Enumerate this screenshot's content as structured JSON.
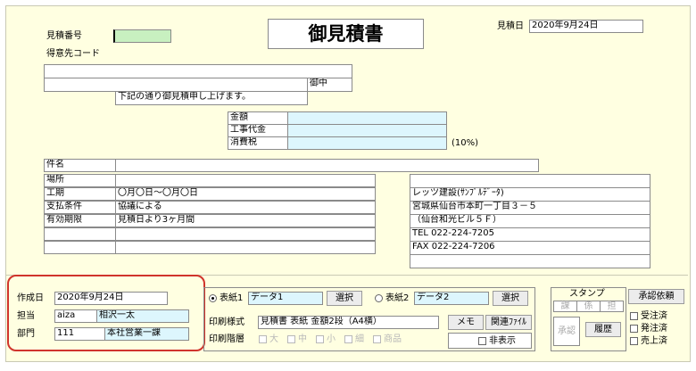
{
  "header": {
    "estimate_no_label": "見積番号",
    "estimate_no_value": "",
    "customer_code_label": "得意先コード",
    "title": "御見積書",
    "date_label": "見積日",
    "date_value": "2020年9月24日"
  },
  "address": {
    "line1": "",
    "line2": "",
    "honorific": "御中",
    "greeting": "下記の通り御見積申し上げます。"
  },
  "amounts": {
    "total_label": "金額",
    "construction_label": "工事代金",
    "tax_label": "消費税",
    "tax_rate": "(10%)"
  },
  "details": {
    "subject_label": "件名",
    "location_label": "場所",
    "period_label": "工期",
    "period_value": "〇月〇日～〇月〇日",
    "payment_label": "支払条件",
    "payment_value": "協議による",
    "validity_label": "有効期限",
    "validity_value": "見積日より3ヶ月間"
  },
  "company": {
    "name": "レッツ建設(ｻﾝﾌﾟﾙﾃﾞｰﾀ)",
    "address1": "宮城県仙台市本町一丁目３－５",
    "address2": "（仙台和光ビル５Ｆ）",
    "tel": "TEL 022-224-7205",
    "fax": "FAX 022-224-7206"
  },
  "creator": {
    "created_label": "作成日",
    "created_value": "2020年9月24日",
    "staff_label": "担当",
    "staff_code": "aiza",
    "staff_name": "相沢一太",
    "dept_label": "部門",
    "dept_code": "111",
    "dept_name": "本社営業一課"
  },
  "print": {
    "cover1_label": "表紙1",
    "cover1_value": "データ1",
    "cover2_label": "表紙2",
    "cover2_value": "データ2",
    "select_label": "選択",
    "style_label": "印刷様式",
    "style_value": "見積書 表紙 金額2段（A4横）",
    "level_label": "印刷階層",
    "levels": [
      "大",
      "中",
      "小",
      "細",
      "商品"
    ]
  },
  "buttons": {
    "memo": "メモ",
    "related_file": "関連ﾌｧｲﾙ",
    "hide": "非表示",
    "approve": "承認",
    "history": "履歴",
    "approval_request": "承認依頼"
  },
  "stamp": {
    "title": "スタンプ",
    "cols": [
      "課",
      "係",
      "担"
    ]
  },
  "status": {
    "order_received": "受注済",
    "ordered": "発注済",
    "sold": "売上済"
  }
}
